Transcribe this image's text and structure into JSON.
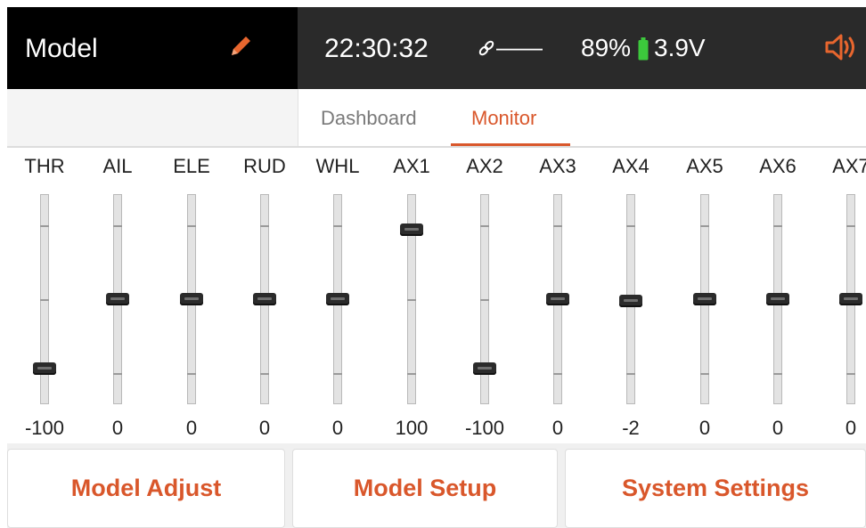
{
  "header": {
    "model_title": "Model",
    "time": "22:30:32",
    "link_status": "——",
    "battery_percent": "89%",
    "voltage": "3.9V",
    "colors": {
      "accent": "#d9572b",
      "battery": "#3cc93c",
      "header_bg": "#2a2a2a",
      "model_bg": "#000000"
    },
    "icons": {
      "edit": "pencil-icon",
      "link": "link-icon",
      "battery": "battery-icon",
      "volume": "speaker-icon"
    }
  },
  "tabs": [
    {
      "label": "Dashboard",
      "active": false
    },
    {
      "label": "Monitor",
      "active": true
    }
  ],
  "channels": [
    {
      "label": "THR",
      "value": "-100",
      "level": -100
    },
    {
      "label": "AIL",
      "value": "0",
      "level": 0
    },
    {
      "label": "ELE",
      "value": "0",
      "level": 0
    },
    {
      "label": "RUD",
      "value": "0",
      "level": 0
    },
    {
      "label": "WHL",
      "value": "0",
      "level": 0
    },
    {
      "label": "AX1",
      "value": "100",
      "level": 100
    },
    {
      "label": "AX2",
      "value": "-100",
      "level": -100
    },
    {
      "label": "AX3",
      "value": "0",
      "level": 0
    },
    {
      "label": "AX4",
      "value": "-2",
      "level": -2
    },
    {
      "label": "AX5",
      "value": "0",
      "level": 0
    },
    {
      "label": "AX6",
      "value": "0",
      "level": 0
    },
    {
      "label": "AX7",
      "value": "0",
      "level": 0
    }
  ],
  "buttons": {
    "model_adjust": "Model Adjust",
    "model_setup": "Model Setup",
    "system_settings": "System Settings"
  }
}
